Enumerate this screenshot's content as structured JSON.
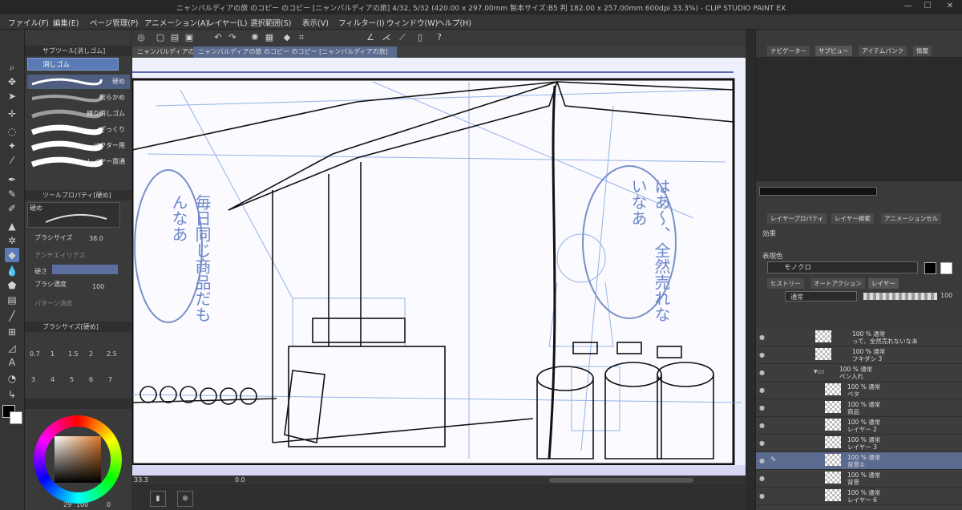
{
  "titlebar": {
    "title": "ニャンバルディアの旅 のコピー のコピー [ニャンバルディアの旅] 4/32, 5/32 (420.00 x 297.00mm 製本サイズ:B5 判 182.00 x 257.00mm 600dpi 33.3%) - CLIP STUDIO PAINT EX",
    "minimize": "—",
    "maximize": "☐",
    "close": "✕"
  },
  "menu": [
    "ファイル(F)",
    "編集(E)",
    "ページ管理(P)",
    "アニメーション(A)",
    "レイヤー(L)",
    "選択範囲(S)",
    "表示(V)",
    "フィルター(I)",
    "ウィンドウ(W)",
    "ヘルプ(H)"
  ],
  "canvas_tabs": [
    {
      "label": "ニャンバルディアの"
    },
    {
      "label": "ニャンバルディアの旅 のコピー のコピー [ニャンバルディアの旅] 4/32, 5/32"
    }
  ],
  "subtool": {
    "header": "サブツール[消しゴム]",
    "group": "消しゴム",
    "brushes": [
      {
        "label": "硬め",
        "selected": true
      },
      {
        "label": "軟らかめ"
      },
      {
        "label": "練り消しゴム"
      },
      {
        "label": "ざっくり"
      },
      {
        "label": "ベクター用"
      },
      {
        "label": "レイヤー貫通"
      }
    ]
  },
  "toolprop": {
    "header": "ツールプロパティ[硬め]",
    "preset": "硬め",
    "brush_size_label": "ブラシサイズ",
    "brush_size": "38.0",
    "antialias_label": "アンチエイリアス",
    "hardness_label": "硬さ",
    "density_label": "ブラシ濃度",
    "density": "100",
    "through_label": "パターン消去"
  },
  "brushsize": {
    "header": "ブラシサイズ[硬め]",
    "values": [
      "0.7",
      "1",
      "1.5",
      "2",
      "2.5",
      "3",
      "4",
      "5",
      "6",
      "7"
    ]
  },
  "color": {
    "main": "#000000",
    "sub": "#ffffff",
    "hue_hex": "#d9782a",
    "h": "29",
    "s": "100",
    "v": "0"
  },
  "speech": {
    "left": "毎日同じ商品だもんなあ",
    "right": "はあ〜、全然売れないなあ"
  },
  "statusbar": {
    "zoom": "33.3",
    "rotation": "0.0"
  },
  "right": {
    "top_tabs": [
      "ナビゲーター",
      "サブビュー",
      "アイテムバンク",
      "情報"
    ],
    "prop_tabs": [
      "レイヤープロパティ",
      "レイヤー検索",
      "アニメーションセル"
    ],
    "effect_label": "効果",
    "expression_label": "表現色",
    "expression_value": "モノクロ",
    "layer_tabs": [
      "ヒストリー",
      "オートアクション",
      "レイヤー"
    ],
    "blend_mode": "通常",
    "opacity": "100",
    "layers": [
      {
        "mode": "100 % 通常",
        "name": "って、全然売れないなあ",
        "indent": 1
      },
      {
        "mode": "100 % 通常",
        "name": "フキダシ 3",
        "indent": 1
      },
      {
        "mode": "100 % 通常",
        "name": "ペン入れ",
        "indent": 0,
        "folder": true
      },
      {
        "mode": "100 % 通常",
        "name": "ベタ",
        "indent": 1
      },
      {
        "mode": "100 % 通常",
        "name": "商品",
        "indent": 1
      },
      {
        "mode": "100 % 通常",
        "name": "レイヤー 2",
        "indent": 1
      },
      {
        "mode": "100 % 通常",
        "name": "レイヤー 3",
        "indent": 1
      },
      {
        "mode": "100 % 通常",
        "name": "背景②",
        "indent": 1,
        "selected": true
      },
      {
        "mode": "100 % 通常",
        "name": "背景",
        "indent": 1
      },
      {
        "mode": "100 % 通常",
        "name": "レイヤー 6",
        "indent": 1
      }
    ]
  }
}
